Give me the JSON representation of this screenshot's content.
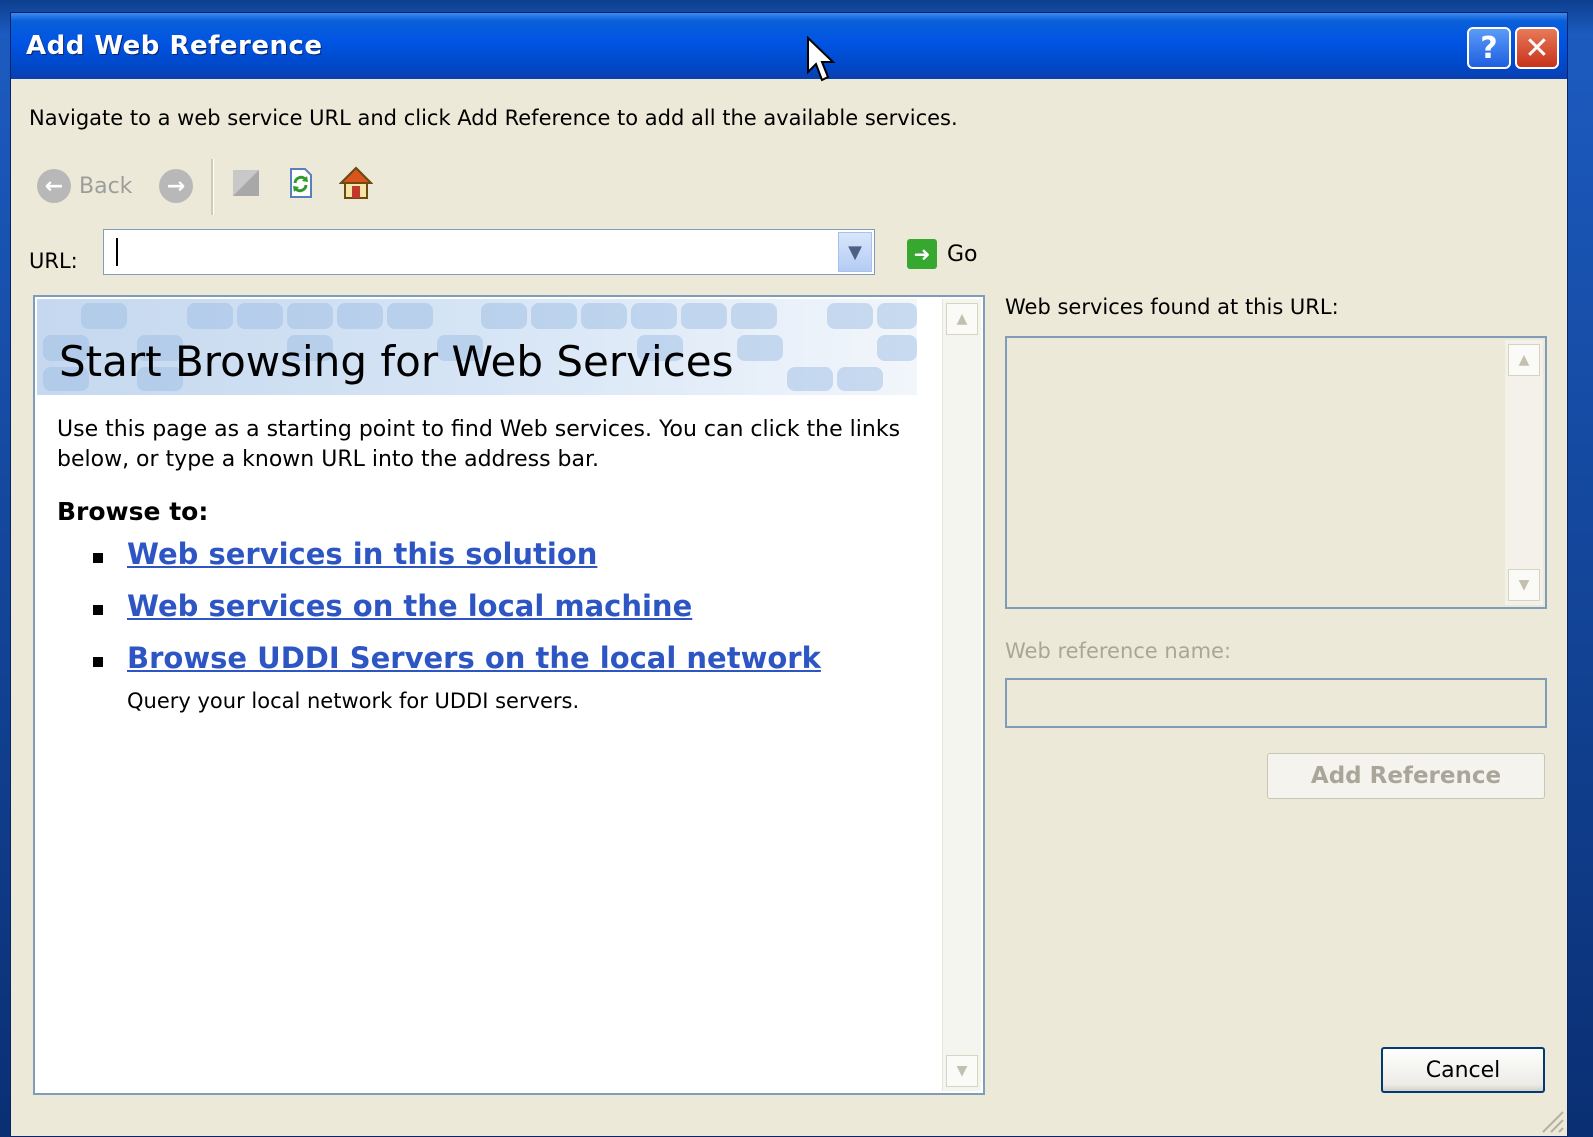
{
  "dialog": {
    "title": "Add Web Reference",
    "help_glyph": "?",
    "close_glyph": "✕",
    "instruction": "Navigate to a web service URL and click Add Reference to add all the available services."
  },
  "toolbar": {
    "back_label": "Back",
    "back_icon": "back-arrow-icon",
    "forward_icon": "forward-arrow-icon",
    "stop_icon": "stop-icon",
    "refresh_icon": "refresh-icon",
    "home_icon": "home-icon"
  },
  "url": {
    "label": "URL:",
    "value": "",
    "go_label": "Go"
  },
  "browser": {
    "title": "Start Browsing for Web Services",
    "intro": "Use this page as a starting point to find Web services. You can click the links below, or type a known URL into the address bar.",
    "browse_to": "Browse to:",
    "links": [
      "Web services in this solution",
      "Web services on the local machine",
      "Browse UDDI Servers on the local network"
    ],
    "link3_description": "Query your local network for UDDI servers."
  },
  "right_panel": {
    "found_label": "Web services found at this URL:",
    "ref_name_label": "Web reference name:",
    "ref_name_value": "",
    "add_reference_label": "Add Reference"
  },
  "footer": {
    "cancel_label": "Cancel"
  },
  "colors": {
    "titlebar": "#0054e3",
    "dialog_bg": "#ece9d8",
    "link": "#2d55c4",
    "disabled_text": "#a9a699"
  }
}
